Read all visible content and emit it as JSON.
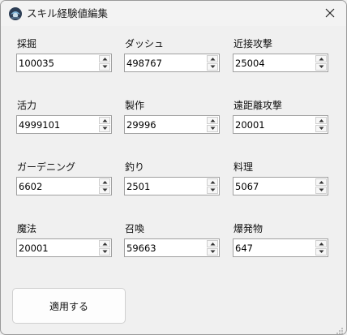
{
  "window": {
    "title": "スキル経験値編集",
    "close_glyph": "✕"
  },
  "skills": [
    {
      "label": "採掘",
      "value": "100035"
    },
    {
      "label": "ダッシュ",
      "value": "498767"
    },
    {
      "label": "近接攻撃",
      "value": "25004"
    },
    {
      "label": "活力",
      "value": "4999101"
    },
    {
      "label": "製作",
      "value": "29996"
    },
    {
      "label": "遠距離攻撃",
      "value": "20001"
    },
    {
      "label": "ガーデニング",
      "value": "6602"
    },
    {
      "label": "釣り",
      "value": "2501"
    },
    {
      "label": "料理",
      "value": "5067"
    },
    {
      "label": "魔法",
      "value": "20001"
    },
    {
      "label": "召喚",
      "value": "59663"
    },
    {
      "label": "爆発物",
      "value": "647"
    }
  ],
  "apply_button": {
    "label": "適用する"
  },
  "icons": {
    "app": "game-logo-icon",
    "close": "close-icon",
    "spin_up": "chevron-up-icon",
    "spin_down": "chevron-down-icon",
    "resize": "resize-grip-icon"
  }
}
